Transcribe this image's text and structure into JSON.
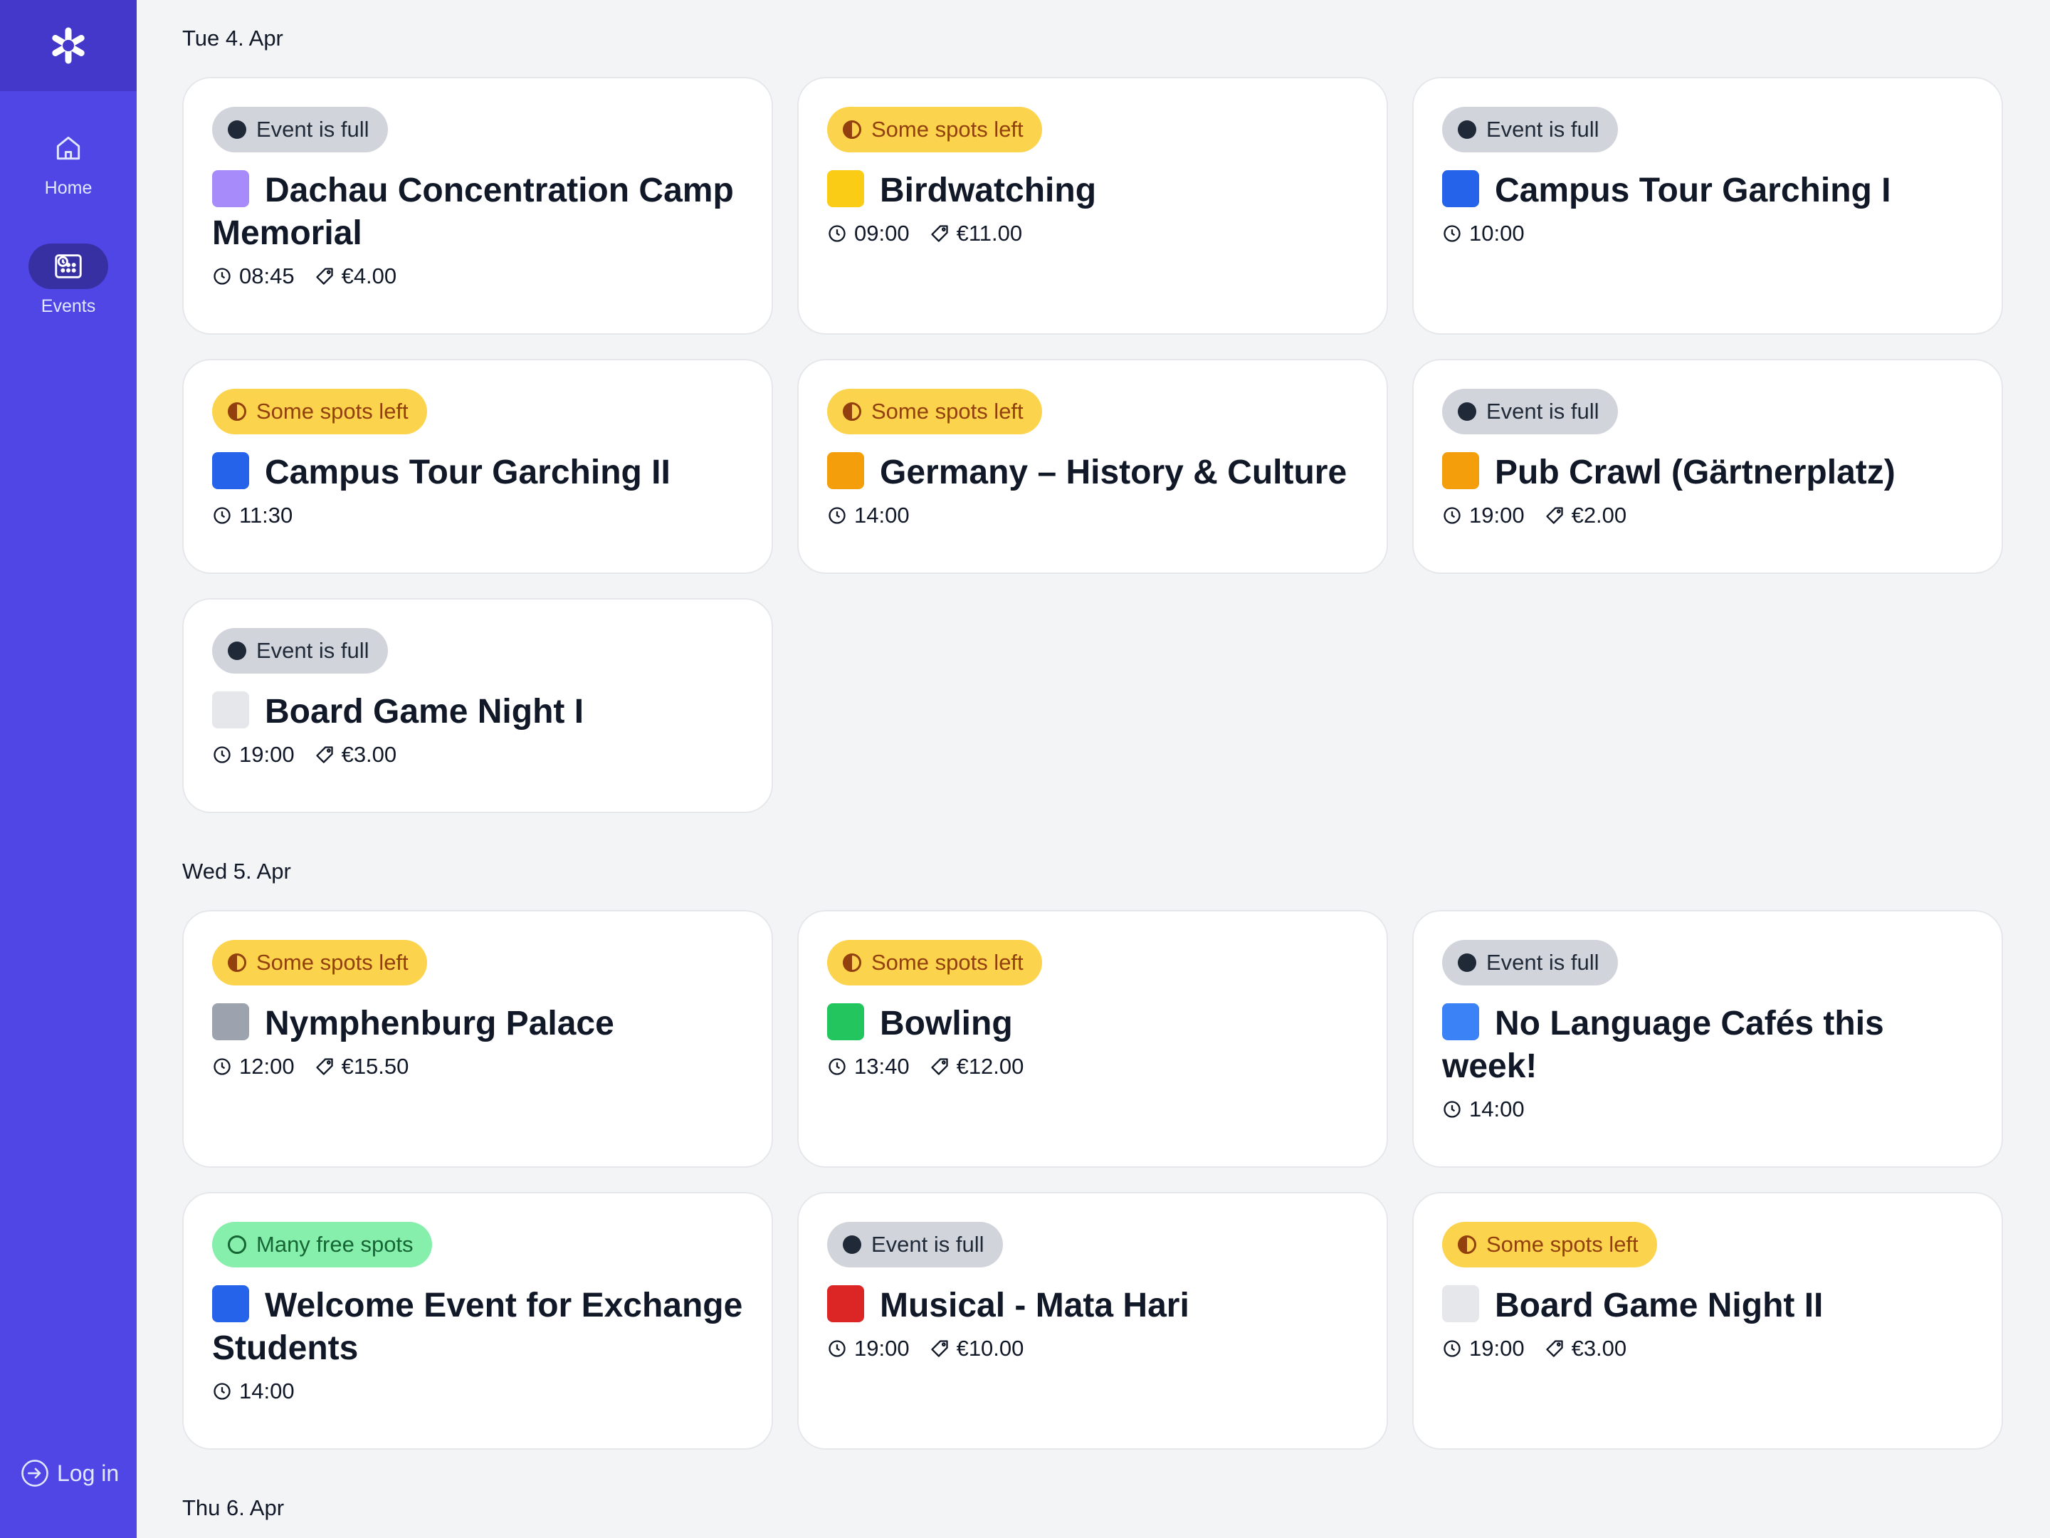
{
  "sidebar": {
    "logo_icon": "asterisk-logo-icon",
    "nav": [
      {
        "label": "Home",
        "icon": "home-icon",
        "active": false
      },
      {
        "label": "Events",
        "icon": "calendar-icon",
        "active": true
      }
    ],
    "login_label": "Log in",
    "colors": {
      "background": "#4f46e5",
      "logo_bg": "#4338ca",
      "active_pill": "#3730a3"
    }
  },
  "days": [
    {
      "label": "Tue 4. Apr",
      "events": [
        {
          "status": "Event is full",
          "status_type": "full",
          "emoji": "headstone",
          "title": "Dachau Concentration Camp Memorial",
          "time": "08:45",
          "price": "€4.00"
        },
        {
          "status": "Some spots left",
          "status_type": "some",
          "emoji": "bird",
          "title": "Birdwatching",
          "time": "09:00",
          "price": "€11.00"
        },
        {
          "status": "Event is full",
          "status_type": "full",
          "emoji": "classical-building",
          "title": "Campus Tour Garching I",
          "time": "10:00",
          "price": ""
        },
        {
          "status": "Some spots left",
          "status_type": "some",
          "emoji": "classical-building",
          "title": "Campus Tour Garching II",
          "time": "11:30",
          "price": ""
        },
        {
          "status": "Some spots left",
          "status_type": "some",
          "emoji": "germany-culture",
          "title": "Germany – History & Culture",
          "time": "14:00",
          "price": ""
        },
        {
          "status": "Event is full",
          "status_type": "full",
          "emoji": "beer-mug",
          "title": "Pub Crawl (Gärtnerplatz)",
          "time": "19:00",
          "price": "€2.00"
        },
        {
          "status": "Event is full",
          "status_type": "full",
          "emoji": "playing-cards",
          "title": "Board Game Night I",
          "time": "19:00",
          "price": "€3.00"
        }
      ]
    },
    {
      "label": "Wed 5. Apr",
      "events": [
        {
          "status": "Some spots left",
          "status_type": "some",
          "emoji": "palace",
          "title": "Nymphenburg Palace",
          "time": "12:00",
          "price": "€15.50"
        },
        {
          "status": "Some spots left",
          "status_type": "some",
          "emoji": "bowling",
          "title": "Bowling",
          "time": "13:40",
          "price": "€12.00"
        },
        {
          "status": "Event is full",
          "status_type": "full",
          "emoji": "coffee-cup",
          "title": "No Language Cafés this week!",
          "time": "14:00",
          "price": ""
        },
        {
          "status": "Many free spots",
          "status_type": "many",
          "emoji": "presentation",
          "title": "Welcome Event for Exchange Students",
          "time": "14:00",
          "price": ""
        },
        {
          "status": "Event is full",
          "status_type": "full",
          "emoji": "theater-curtain",
          "title": "Musical - Mata Hari",
          "time": "19:00",
          "price": "€10.00"
        },
        {
          "status": "Some spots left",
          "status_type": "some",
          "emoji": "playing-cards",
          "title": "Board Game Night II",
          "time": "19:00",
          "price": "€3.00"
        }
      ]
    },
    {
      "label": "Thu 6. Apr",
      "events": []
    }
  ]
}
